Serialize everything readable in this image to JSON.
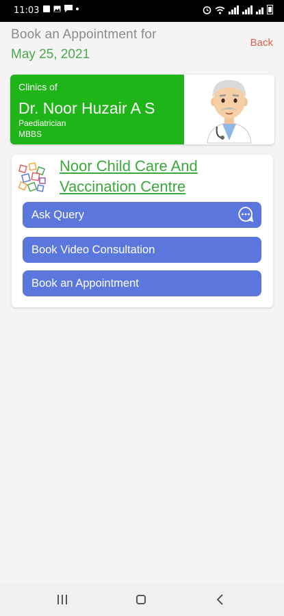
{
  "status_bar": {
    "time": "11:03",
    "notification_icons": [
      "square-icon",
      "image-icon",
      "message-icon",
      "dot-icon"
    ],
    "system_icons": [
      "alarm-icon",
      "wifi-icon",
      "signal-icon",
      "signal-icon",
      "signal-icon",
      "battery-icon"
    ]
  },
  "header": {
    "title": "Book an Appointment for",
    "date": "May 25, 2021",
    "back_label": "Back"
  },
  "doctor": {
    "clinics_of_label": "Clinics of",
    "name": "Dr. Noor Huzair A S",
    "specialty": "Paediatrician",
    "degree": "MBBS",
    "avatar_icon": "doctor-avatar-icon"
  },
  "clinic": {
    "name": "Noor Child Care And Vaccination Centre",
    "logo_icon": "clinic-logo-icon",
    "buttons": [
      {
        "label": "Ask Query",
        "icon": "chat-bubble-icon"
      },
      {
        "label": "Book Video Consultation"
      },
      {
        "label": "Book an Appointment"
      }
    ]
  },
  "nav_bar": {
    "items": [
      "recent-apps-icon",
      "home-icon",
      "back-icon"
    ]
  },
  "colors": {
    "green": "#1fb417",
    "date_green": "#4aa84a",
    "button_blue": "#5b77dd",
    "back_red": "#e05d4f"
  }
}
